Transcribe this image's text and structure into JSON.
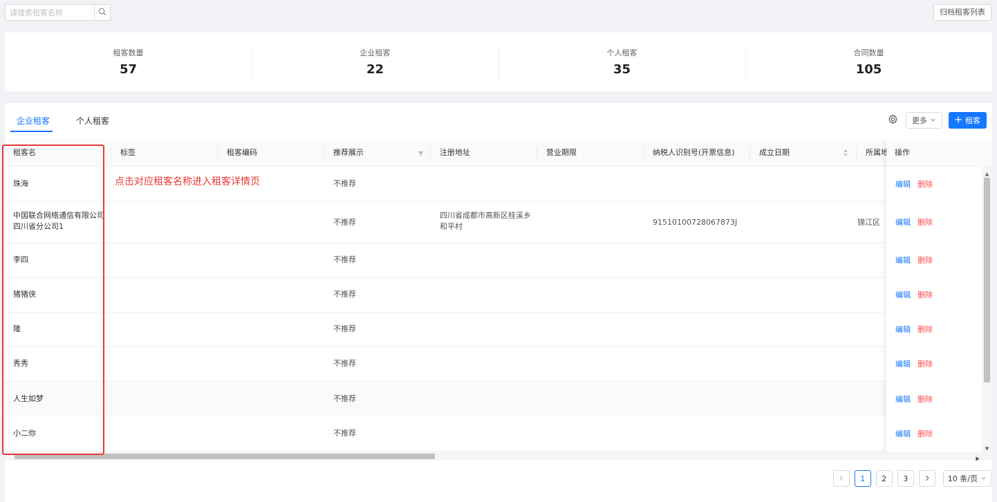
{
  "search": {
    "placeholder": "请搜索租客名称"
  },
  "archive_label": "归档租客列表",
  "stats": [
    {
      "label": "租客数量",
      "value": "57"
    },
    {
      "label": "企业租客",
      "value": "22"
    },
    {
      "label": "个人租客",
      "value": "35"
    },
    {
      "label": "合同数量",
      "value": "105"
    }
  ],
  "tabs": [
    {
      "label": "企业租客",
      "active": true
    },
    {
      "label": "个人租客",
      "active": false
    }
  ],
  "toolbar": {
    "more_label": "更多",
    "add_label": "租客"
  },
  "table": {
    "columns": [
      "租客名",
      "标签",
      "租客编码",
      "推荐展示",
      "注册地址",
      "营业期限",
      "纳税人识别号(开票信息)",
      "成立日期",
      "所属地",
      "操作"
    ],
    "rows": [
      {
        "name": "珠海",
        "recommend": "不推荐",
        "address": "",
        "tax_id": "",
        "region": ""
      },
      {
        "name": "中国联合网络通信有限公司四川省分公司1",
        "recommend": "不推荐",
        "address": "四川省成都市高新区桂溪乡和平村",
        "tax_id": "91510100728067873J",
        "region": "锦江区"
      },
      {
        "name": "李四",
        "recommend": "不推荐",
        "address": "",
        "tax_id": "",
        "region": ""
      },
      {
        "name": "猪猪侠",
        "recommend": "不推荐",
        "address": "",
        "tax_id": "",
        "region": ""
      },
      {
        "name": "隆",
        "recommend": "不推荐",
        "address": "",
        "tax_id": "",
        "region": ""
      },
      {
        "name": "秀秀",
        "recommend": "不推荐",
        "address": "",
        "tax_id": "",
        "region": ""
      },
      {
        "name": "人生如梦",
        "recommend": "不推荐",
        "address": "",
        "tax_id": "",
        "region": ""
      },
      {
        "name": "小二你",
        "recommend": "不推荐",
        "address": "",
        "tax_id": "",
        "region": ""
      }
    ],
    "edit_label": "编辑",
    "delete_label": "删除"
  },
  "annotation": "点击对应租客名称进入租客详情页",
  "pagination": {
    "pages": [
      "1",
      "2",
      "3"
    ],
    "current": "1",
    "page_size": "10 条/页"
  },
  "colors": {
    "primary": "#1677ff",
    "danger": "#ff4d4f",
    "annotation": "#e53935"
  }
}
